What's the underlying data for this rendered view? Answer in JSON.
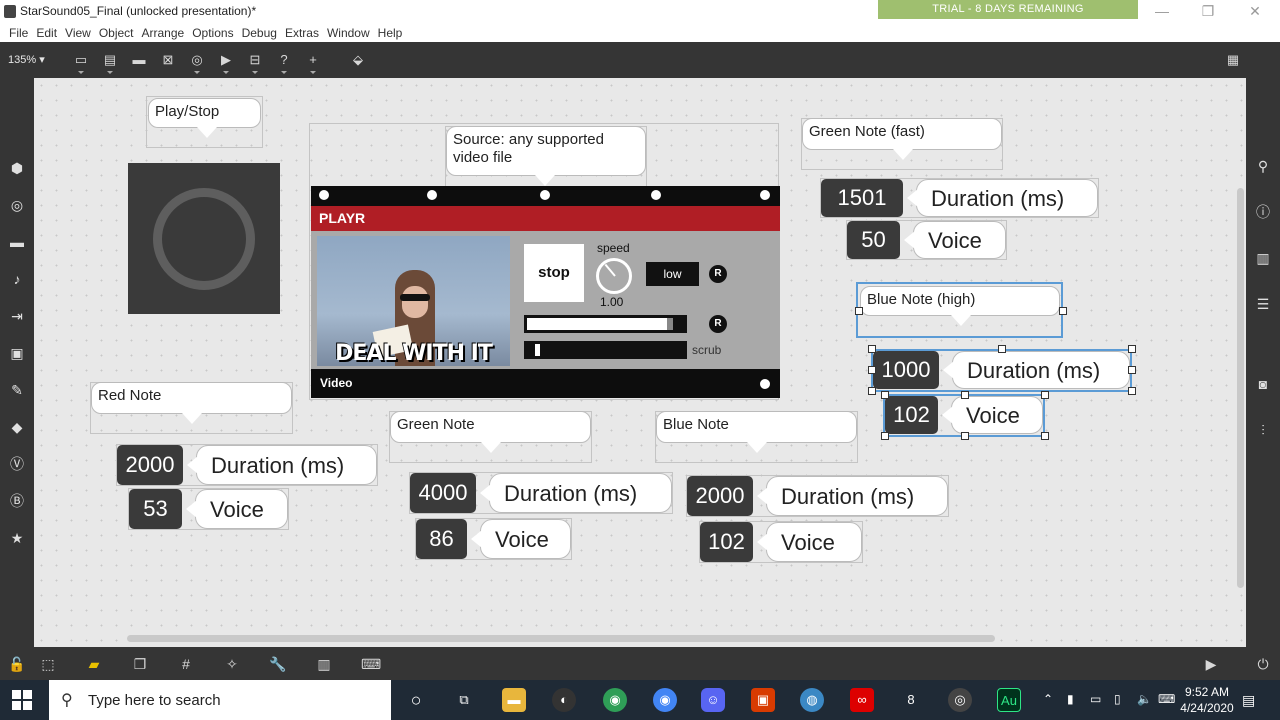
{
  "window": {
    "title": "StarSound05_Final (unlocked presentation)*",
    "trial_banner": "TRIAL - 8 DAYS REMAINING",
    "min_glyph": "—",
    "max_glyph": "❐",
    "close_glyph": "✕"
  },
  "menu": [
    "File",
    "Edit",
    "View",
    "Object",
    "Arrange",
    "Options",
    "Debug",
    "Extras",
    "Window",
    "Help"
  ],
  "toolbar": {
    "zoom": "135% ▾"
  },
  "patcher": {
    "play_stop_label": "Play/Stop",
    "source_comment": "Source: any supported video file",
    "playr": {
      "title": "PLAYR",
      "stop_label": "stop",
      "speed_label": "speed",
      "speed_value": "1.00",
      "low_label": "low",
      "r_label": "R",
      "scrub_label": "scrub",
      "video_label": "Video",
      "meme_text": "DEAL WITH IT",
      "volume_level": 0.93,
      "scrub_level": 0.05
    },
    "groups": [
      {
        "comment": "Green Note (fast)",
        "duration": "1501",
        "voice": "50"
      },
      {
        "comment": "Blue Note (high)",
        "duration": "1000",
        "voice": "102"
      },
      {
        "comment": "Red Note",
        "duration": "2000",
        "voice": "53"
      },
      {
        "comment": "Green Note",
        "duration": "4000",
        "voice": "86"
      },
      {
        "comment": "Blue Note",
        "duration": "2000",
        "voice": "102"
      }
    ],
    "duration_label": "Duration (ms)",
    "voice_label": "Voice"
  },
  "taskbar": {
    "search_placeholder": "Type here to search",
    "time": "9:52 AM",
    "date": "4/24/2020"
  },
  "colors": {
    "accent_trial": "#9fbf6f",
    "playr_header": "#b01e25",
    "selection": "#5b9bd5"
  }
}
